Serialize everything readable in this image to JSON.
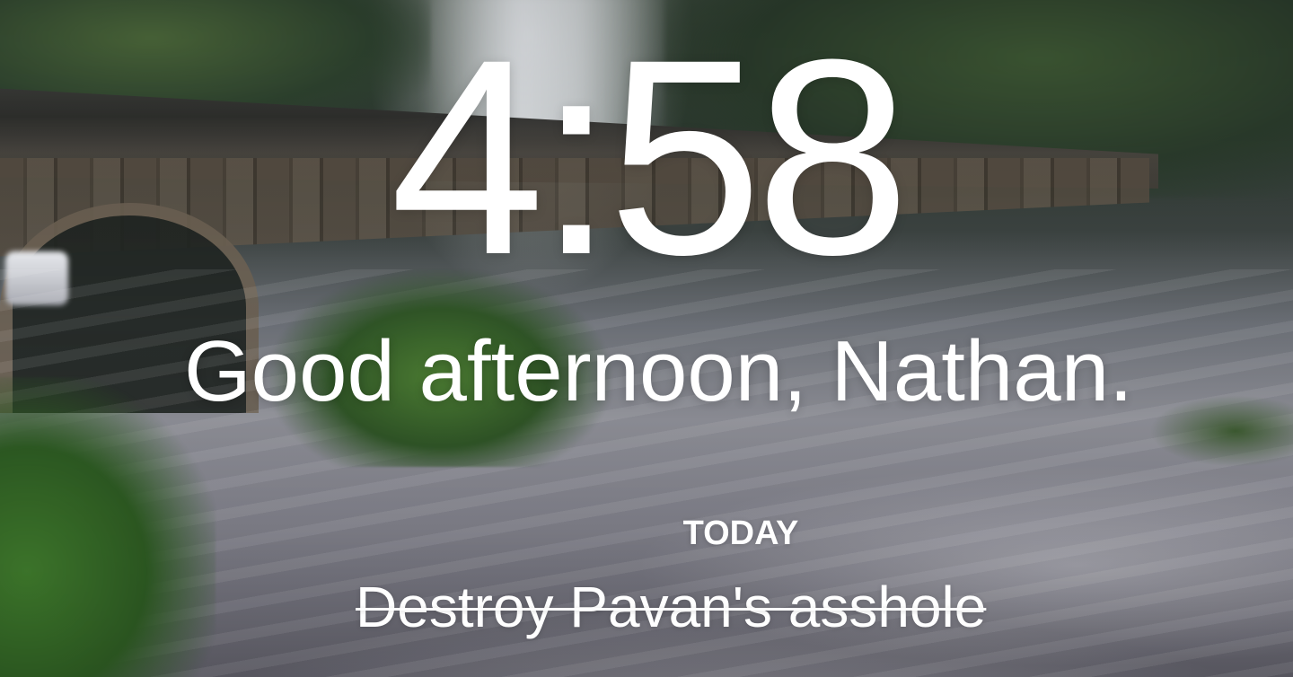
{
  "clock": {
    "time": "4:58"
  },
  "greeting": {
    "text": "Good afternoon, Nathan."
  },
  "focus": {
    "label": "TODAY",
    "task": "Destroy Pavan's asshole",
    "completed": true
  },
  "background": {
    "description_icon": "landscape-photo"
  }
}
